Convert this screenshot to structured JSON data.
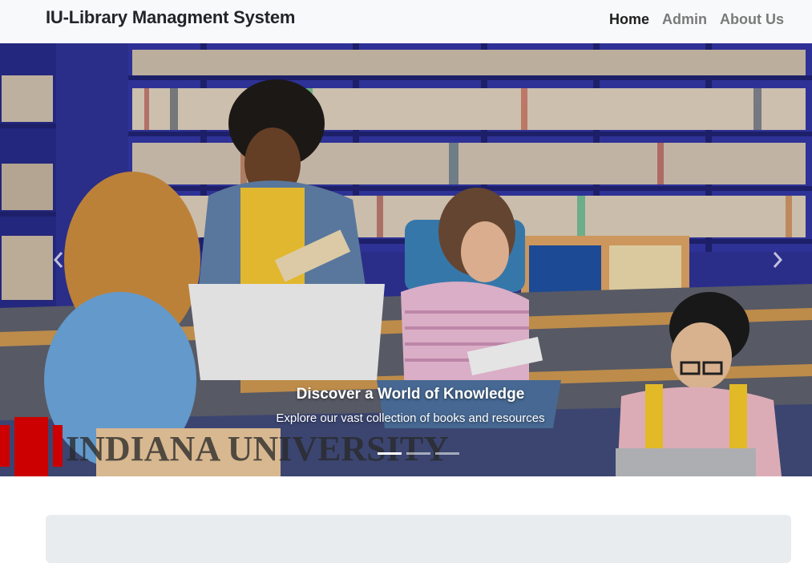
{
  "navbar": {
    "brand": "IU-Library Managment System",
    "links": [
      {
        "label": "Home",
        "active": true
      },
      {
        "label": "Admin",
        "active": false
      },
      {
        "label": "About Us",
        "active": false
      }
    ]
  },
  "carousel": {
    "caption_title": "Discover a World of Knowledge",
    "caption_text": "Explore our vast collection of books and resources",
    "logo_text": "INDIANA UNIVERSITY",
    "slide_count": 3,
    "active_slide": 1,
    "prev_icon": "chevron-left-icon",
    "next_icon": "chevron-right-icon"
  },
  "colors": {
    "navbar_bg": "#f8f9fa",
    "shelf_blue": "#2b2f8f",
    "iu_crimson": "#cc0000",
    "jumbotron_bg": "#e9ecef"
  }
}
